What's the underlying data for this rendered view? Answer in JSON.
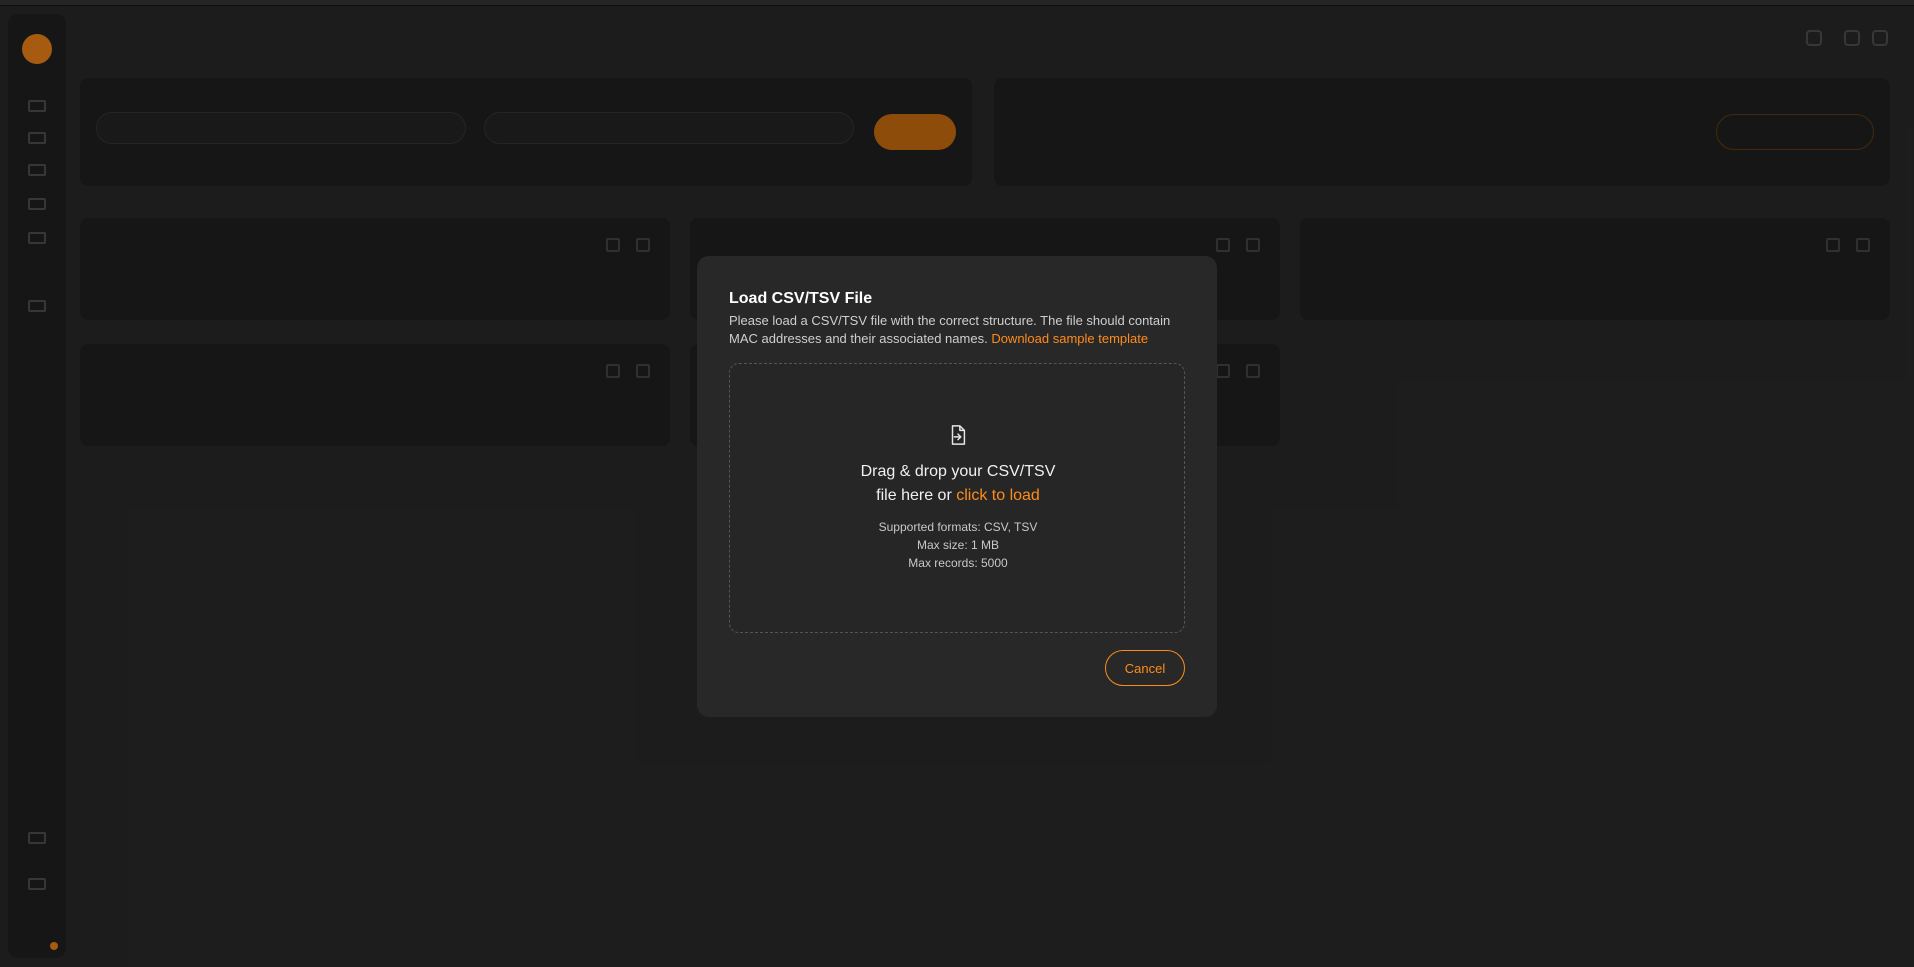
{
  "modal": {
    "title": "Load CSV/TSV File",
    "description": "Please load a CSV/TSV file with the correct structure. The file should contain MAC addresses and their associated names.",
    "download_link": "Download sample template",
    "dropzone": {
      "line1": "Drag & drop your CSV/TSV",
      "line2_prefix": "file here or",
      "click_link": "click to load",
      "formats": "Supported formats: CSV, TSV",
      "max_size": "Max size: 1 MB",
      "max_records": "Max records: 5000"
    },
    "cancel_label": "Cancel"
  },
  "colors": {
    "accent": "#ff8c1a",
    "modal_bg": "#282828",
    "page_bg": "#2c2c2c"
  }
}
